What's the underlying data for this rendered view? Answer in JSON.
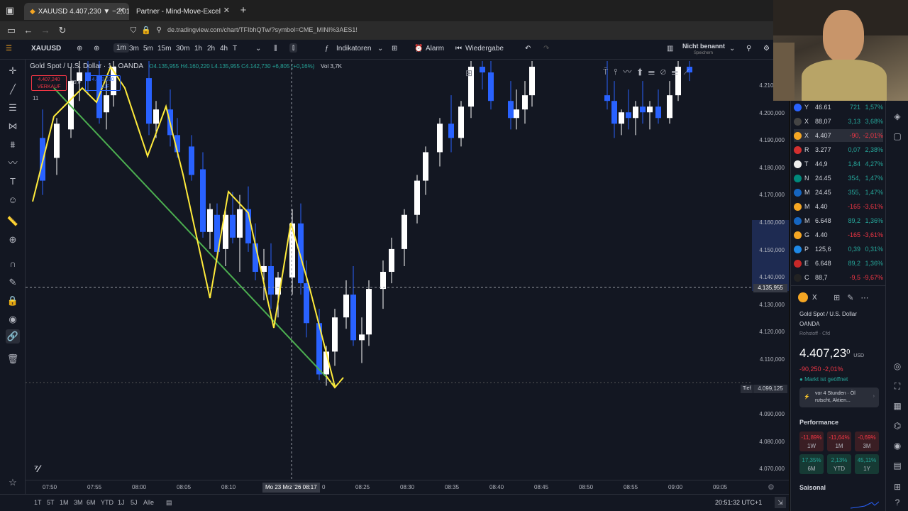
{
  "browser": {
    "tabs": [
      {
        "label": "XAUUSD 4.407,230 ▼ −2,01% N",
        "active": true
      },
      {
        "label": "Partner - Mind-Move-Excel",
        "active": false
      }
    ],
    "url": "de.tradingview.com/chart/TFIbhQTw/?symbol=CME_MINI%3AES1!"
  },
  "toolbar": {
    "symbol": "XAUUSD",
    "intervals": [
      "1m",
      "3m",
      "5m",
      "15m",
      "30m",
      "1h",
      "2h",
      "4h",
      "T"
    ],
    "selected_interval": "1m",
    "indicators_label": "Indikatoren",
    "alarm_label": "Alarm",
    "replay_label": "Wiedergabe",
    "layout_name": "Nicht benannt",
    "layout_sub": "Speichern"
  },
  "legend": {
    "title": "Gold Spot / U.S. Dollar · 1 · OANDA",
    "ohlc": "O4.135,955 H4.160,220 L4.135,955 C4.142,730 +6,805 (+0,16%)",
    "vol": "Vol 3,7K",
    "sell_price": "4.407,240",
    "sell_label": "VERKAUF",
    "spread": "79,0",
    "buy_price": "4.408,030",
    "buy_label": "KAUF",
    "count": "11"
  },
  "price_axis": {
    "labels": [
      "4.210,000",
      "4.200,000",
      "4.190,000",
      "4.180,000",
      "4.170,000",
      "4.160,000",
      "4.150,000",
      "4.140,000",
      "4.130,000",
      "4.120,000",
      "4.110,000",
      "4.100,000",
      "4.090,000",
      "4.080,000",
      "4.070,000"
    ],
    "crosshair_price": "4.135,955",
    "low_tag": "Tief",
    "low_price": "4.099,125"
  },
  "time_axis": {
    "labels": [
      "07:50",
      "07:55",
      "08:00",
      "08:05",
      "08:10",
      "08:25",
      "08:30",
      "08:35",
      "08:40",
      "08:45",
      "08:50",
      "08:55",
      "09:00",
      "09:05"
    ],
    "crosshair_time": "Mo 23 Mrz '26   08:17",
    "crosshair_trail": "0"
  },
  "bottom": {
    "ranges": [
      "1T",
      "5T",
      "1M",
      "3M",
      "6M",
      "YTD",
      "1J",
      "5J",
      "Alle"
    ],
    "clock": "20:51:32 UTC+1"
  },
  "watchlist": [
    {
      "sym": "Y",
      "price": "46.61",
      "chg": "721",
      "pct": "1,57%",
      "dir": "pos",
      "color": "#2962ff"
    },
    {
      "sym": "X",
      "price": "88,07",
      "chg": "3,13",
      "pct": "3,68%",
      "dir": "pos",
      "color": "#444"
    },
    {
      "sym": "X",
      "price": "4.407",
      "chg": "-90,",
      "pct": "-2,01%",
      "dir": "neg",
      "color": "#f5a623"
    },
    {
      "sym": "R",
      "price": "3.277",
      "chg": "0,07",
      "pct": "2,38%",
      "dir": "pos",
      "color": "#d32f2f"
    },
    {
      "sym": "T",
      "price": "44,9",
      "chg": "1,84",
      "pct": "4,27%",
      "dir": "pos",
      "color": "#eee"
    },
    {
      "sym": "N",
      "price": "24.45",
      "chg": "354,",
      "pct": "1,47%",
      "dir": "pos",
      "color": "#00897b"
    },
    {
      "sym": "M",
      "price": "24.45",
      "chg": "355,",
      "pct": "1,47%",
      "dir": "pos",
      "color": "#1565c0"
    },
    {
      "sym": "M",
      "price": "4.40",
      "chg": "-165",
      "pct": "-3,61%",
      "dir": "neg",
      "color": "#f5a623"
    },
    {
      "sym": "M",
      "price": "6.648",
      "chg": "89,2",
      "pct": "1,36%",
      "dir": "pos",
      "color": "#1565c0"
    },
    {
      "sym": "G",
      "price": "4.40",
      "chg": "-165",
      "pct": "-3,61%",
      "dir": "neg",
      "color": "#f5a623"
    },
    {
      "sym": "P",
      "price": "125,6",
      "chg": "0,39",
      "pct": "0,31%",
      "dir": "pos",
      "color": "#1e88e5"
    },
    {
      "sym": "E",
      "price": "6.648",
      "chg": "89,2",
      "pct": "1,36%",
      "dir": "pos",
      "color": "#c62828"
    },
    {
      "sym": "C",
      "price": "88,7",
      "chg": "-9,5",
      "pct": "-9,67%",
      "dir": "neg",
      "color": "#222"
    }
  ],
  "details": {
    "symbol_short": "X",
    "name": "Gold Spot / U.S. Dollar",
    "exchange": "OANDA",
    "category": "Rohstoff · Cfd",
    "price": "4.407,23",
    "price_sup": "0",
    "currency": "USD",
    "change": "-90,250  -2,01%",
    "market_status": "Markt ist geöffnet",
    "news": "vor 4 Stunden · Öl rutscht, Aktien...",
    "performance_title": "Performance",
    "performance": [
      {
        "pct": "-11,89%",
        "label": "1W",
        "dir": "neg"
      },
      {
        "pct": "-11,64%",
        "label": "1M",
        "dir": "neg"
      },
      {
        "pct": "-0,69%",
        "label": "3M",
        "dir": "neg"
      },
      {
        "pct": "17,35%",
        "label": "6M",
        "dir": "pos"
      },
      {
        "pct": "2,13%",
        "label": "YTD",
        "dir": "pos"
      },
      {
        "pct": "45,11%",
        "label": "1Y",
        "dir": "pos"
      }
    ],
    "seasonal_title": "Saisonal"
  },
  "colors": {
    "bg": "#131722",
    "up_candle": "#ffffff",
    "down_candle": "#2962ff",
    "zigzag": "#ffeb3b",
    "trendline": "#4caf50"
  }
}
